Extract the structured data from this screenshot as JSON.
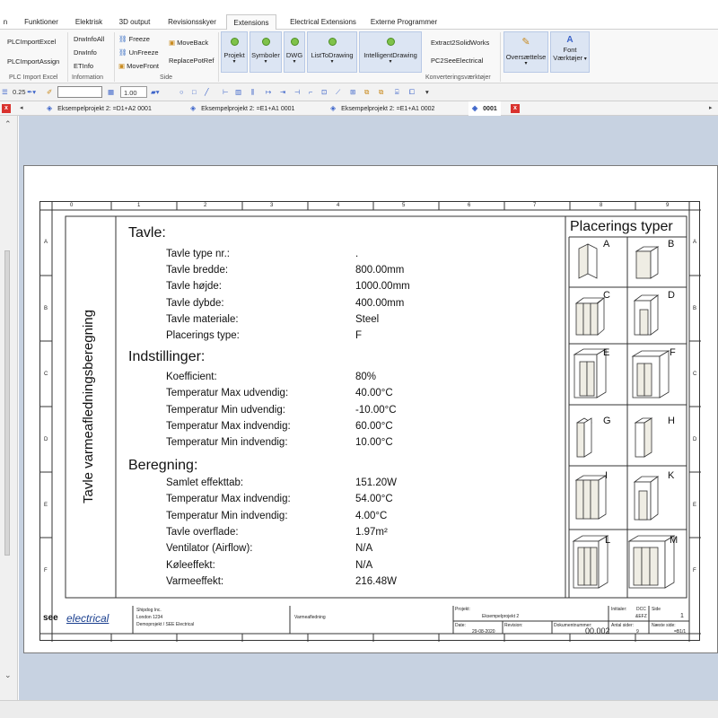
{
  "menu": {
    "tabs": [
      "n",
      "Funktioner",
      "Elektrisk",
      "3D output",
      "Revisionsskyer",
      "Extensions",
      "Electrical Extensions",
      "Externe Programmer"
    ]
  },
  "ribbon": {
    "plc_import_excel": "PLCImportExcel",
    "plc_import_assign": "PLCImportAssign",
    "group_plc": "PLC Import Excel",
    "drwinfo_all": "DrwInfoAll",
    "drwinfo": "DrwInfo",
    "etinfo": "ETInfo",
    "group_information": "Information",
    "freeze": "Freeze",
    "unfreeze": "UnFreeze",
    "movefront": "MoveFront",
    "moveback": "MoveBack",
    "replacepotref": "ReplacePotRef",
    "group_side": "Side",
    "projekt": "Projekt",
    "symboler": "Symboler",
    "dwg": "DWG",
    "listtodrawing": "ListToDrawing",
    "intelligentdrawing": "IntelligentDrawing",
    "extract2solidworks": "Extract2SolidWorks",
    "pc2seeelectrical": "PC2SeeElectrical",
    "group_konvertering": "Konverteringsværktøjer",
    "oversaettelse": "Oversættelse",
    "font": "Font",
    "vaerktojer": "Værktøjer"
  },
  "toolbar": {
    "line_width": "0.25",
    "scale": "1.00"
  },
  "doc_tabs": {
    "tab1": "Eksempelprojekt 2: =D1+A2 0001",
    "tab2": "Eksempelprojekt 2: =E1+A1 0001",
    "tab3": "Eksempelprojekt 2: =E1+A1 0002",
    "tab4": "0001"
  },
  "sheet": {
    "vertical_title": "Tavle varmeafledningsberegning",
    "col_numbers": [
      "0",
      "1",
      "2",
      "3",
      "4",
      "5",
      "6",
      "7",
      "8",
      "9"
    ],
    "row_letters": [
      "A",
      "B",
      "C",
      "D",
      "E",
      "F"
    ],
    "section_tavle": "Tavle:",
    "tavle_rows": [
      {
        "label": "Tavle type nr.:",
        "value": "."
      },
      {
        "label": "Tavle bredde:",
        "value": "800.00mm"
      },
      {
        "label": "Tavle højde:",
        "value": "1000.00mm"
      },
      {
        "label": "Tavle dybde:",
        "value": "400.00mm"
      },
      {
        "label": "Tavle materiale:",
        "value": "Steel"
      },
      {
        "label": "Placerings type:",
        "value": "F"
      }
    ],
    "section_indstillinger": "Indstillinger:",
    "indstillinger_rows": [
      {
        "label": "Koefficient:",
        "value": "80%"
      },
      {
        "label": "Temperatur Max udvendig:",
        "value": "40.00°C"
      },
      {
        "label": "Temperatur Min udvendig:",
        "value": "-10.00°C"
      },
      {
        "label": "Temperatur Max indvendig:",
        "value": "60.00°C"
      },
      {
        "label": "Temperatur Min indvendig:",
        "value": "10.00°C"
      }
    ],
    "section_beregning": "Beregning:",
    "beregning_rows": [
      {
        "label": "Samlet effekttab:",
        "value": "151.20W"
      },
      {
        "label": "Temperatur Max indvendig:",
        "value": "54.00°C"
      },
      {
        "label": "Temperatur Min indvendig:",
        "value": "4.00°C"
      },
      {
        "label": "Tavle overflade:",
        "value": "1.97m²"
      },
      {
        "label": "Ventilator (Airflow):",
        "value": "N/A"
      },
      {
        "label": "Køleeffekt:",
        "value": "N/A"
      },
      {
        "label": "Varmeeffekt:",
        "value": "216.48W"
      }
    ],
    "placerings_title": "Placerings typer",
    "placerings_letters": [
      "A",
      "B",
      "C",
      "D",
      "E",
      "F",
      "G",
      "H",
      "I",
      "K",
      "L",
      "M"
    ]
  },
  "titleblock": {
    "logo_see": "see",
    "logo_electrical": "electrical",
    "company_1": "Shipdog Inc.",
    "company_2": "London 1234",
    "company_3": "Demoprojekt / SEE Electrical",
    "drawing_title": "Varmeafledning",
    "projekt_label": "Projekt:",
    "projekt_value": "Eksempelprojekt 2",
    "date_label": "Date:",
    "date_value": "29-08-2020",
    "revision_label": "Revision:",
    "dok_label": "Dokumentnummer:",
    "dok_value": "00.002",
    "initialer_label": "Initialer:",
    "dcc_label": "DCC",
    "dcc_value": "&EFZ",
    "side_label": "Side",
    "side_value": "1",
    "antal_label": "Antal sider:",
    "antal_value": "9",
    "naeste_label": "Næste side:",
    "naeste_value": "=B1/1"
  }
}
